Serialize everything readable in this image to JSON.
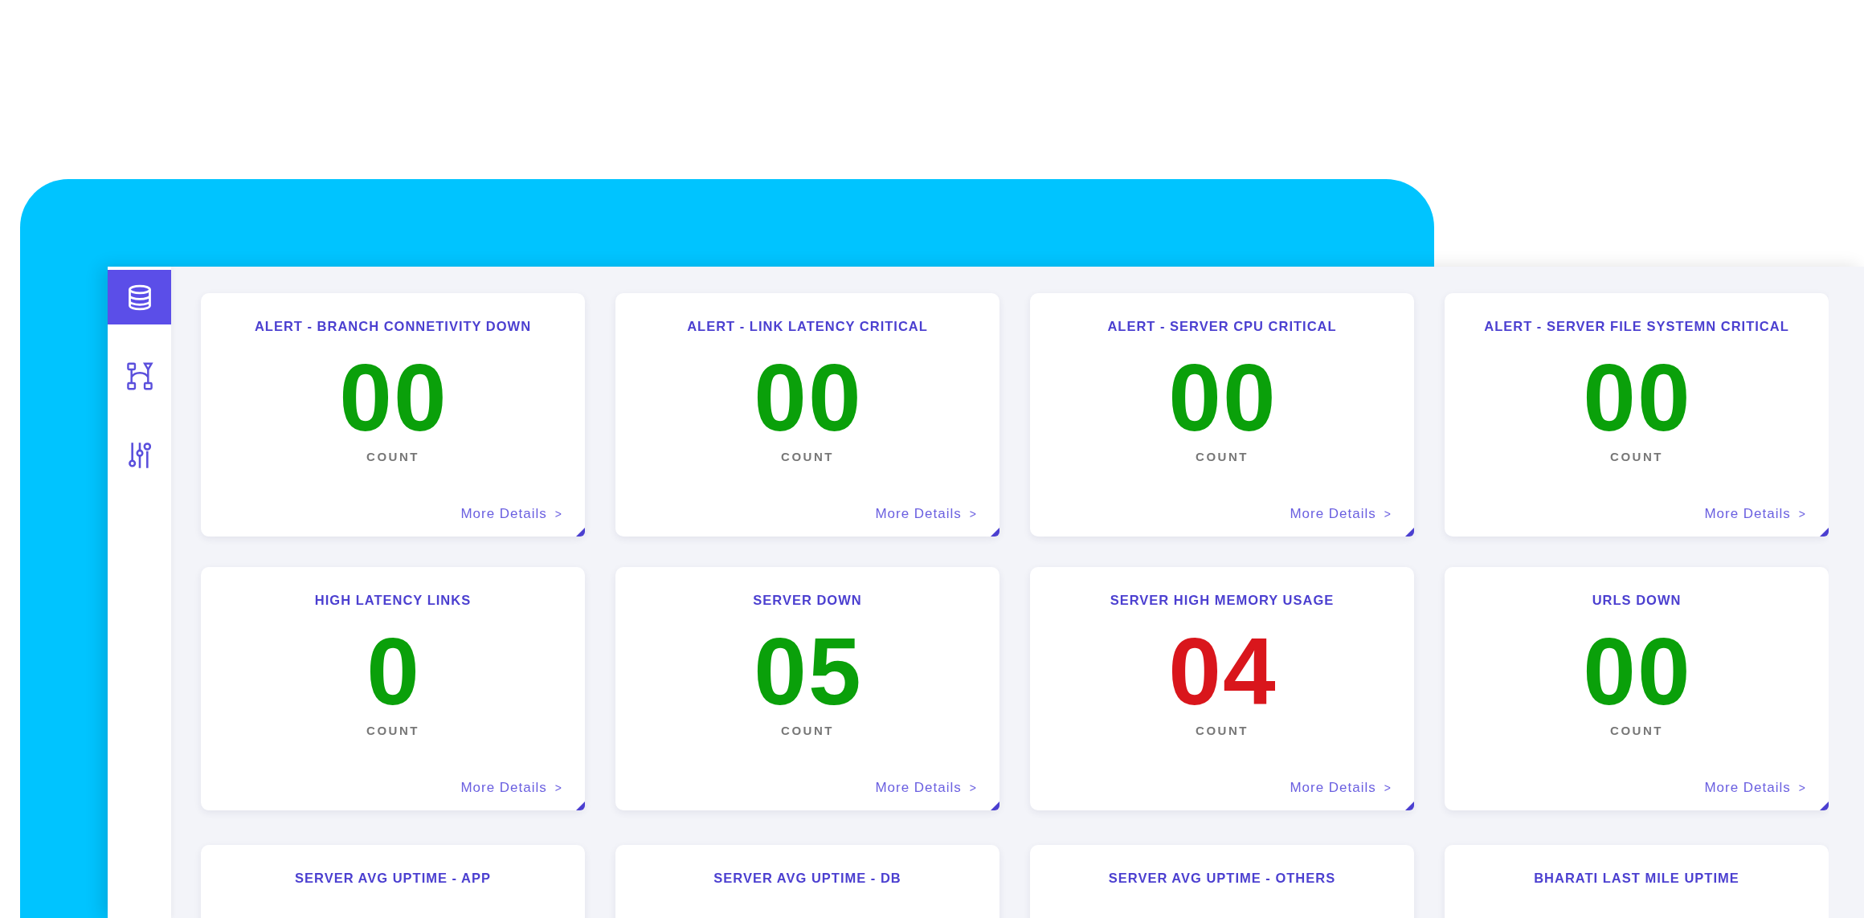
{
  "sidebar": {
    "items": [
      {
        "kind": "database",
        "selected": true
      },
      {
        "kind": "network",
        "selected": false
      },
      {
        "kind": "sliders",
        "selected": false
      }
    ]
  },
  "cards": [
    {
      "title": "ALERT - BRANCH CONNETIVITY DOWN",
      "value": "00",
      "color": "#0aa00a",
      "caption": "COUNT",
      "link": "More Details",
      "link_icon": ">"
    },
    {
      "title": "ALERT - LINK LATENCY CRITICAL",
      "value": "00",
      "color": "#0aa00a",
      "caption": "COUNT",
      "link": "More Details",
      "link_icon": ">"
    },
    {
      "title": "ALERT - SERVER CPU CRITICAL",
      "value": "00",
      "color": "#0aa00a",
      "caption": "COUNT",
      "link": "More Details",
      "link_icon": ">"
    },
    {
      "title": "ALERT - SERVER FILE SYSTEMN CRITICAL",
      "value": "00",
      "color": "#0aa00a",
      "caption": "COUNT",
      "link": "More Details",
      "link_icon": ">"
    },
    {
      "title": "HIGH LATENCY LINKS",
      "value": "0",
      "color": "#0aa00a",
      "caption": "COUNT",
      "link": "More Details",
      "link_icon": ">"
    },
    {
      "title": "SERVER DOWN",
      "value": "05",
      "color": "#0aa00a",
      "caption": "COUNT",
      "link": "More Details",
      "link_icon": ">"
    },
    {
      "title": "SERVER HIGH MEMORY USAGE",
      "value": "04",
      "color": "#d9161c",
      "caption": "COUNT",
      "link": "More Details",
      "link_icon": ">"
    },
    {
      "title": "URLS DOWN",
      "value": "00",
      "color": "#0aa00a",
      "caption": "COUNT",
      "link": "More Details",
      "link_icon": ">"
    },
    {
      "title": "SERVER AVG UPTIME - APP"
    },
    {
      "title": "SERVER AVG UPTIME - DB"
    },
    {
      "title": "SERVER AVG UPTIME - OTHERS"
    },
    {
      "title": "BHARATI LAST MILE UPTIME"
    }
  ]
}
